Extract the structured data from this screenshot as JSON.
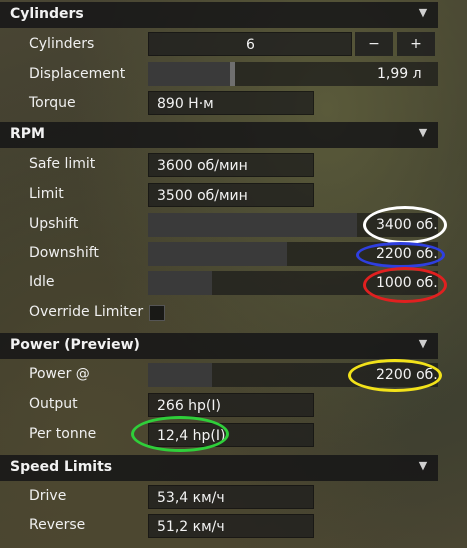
{
  "sections": {
    "cylinders": {
      "title": "Cylinders",
      "cylinders_label": "Cylinders",
      "cylinders_value": "6",
      "minus_label": "−",
      "plus_label": "+",
      "displacement_label": "Displacement",
      "displacement_value": "1,99 л",
      "displacement_fill": 0.3,
      "torque_label": "Torque",
      "torque_value": "890 Н·м"
    },
    "rpm": {
      "title": "RPM",
      "safe_limit_label": "Safe limit",
      "safe_limit_value": "3600 об/мин",
      "limit_label": "Limit",
      "limit_value": "3500 об/мин",
      "upshift_label": "Upshift",
      "upshift_value": "3400 об.",
      "upshift_fill": 0.72,
      "downshift_label": "Downshift",
      "downshift_value": "2200 об.",
      "downshift_fill": 0.48,
      "idle_label": "Idle",
      "idle_value": "1000 об.",
      "idle_fill": 0.22,
      "override_label": "Override Limiter"
    },
    "power": {
      "title": "Power (Preview)",
      "power_at_label": "Power @",
      "power_at_value": "2200 об.",
      "power_at_fill": 0.22,
      "output_label": "Output",
      "output_value": "266 hp(I)",
      "per_tonne_label": "Per tonne",
      "per_tonne_value": "12,4 hp(I)"
    },
    "speed": {
      "title": "Speed Limits",
      "drive_label": "Drive",
      "drive_value": "53,4 км/ч",
      "reverse_label": "Reverse",
      "reverse_value": "51,2 км/ч"
    }
  },
  "annotation_colors": {
    "upshift": "#ffffff",
    "downshift": "#2f3fe0",
    "idle": "#e02020",
    "power_at": "#f2e21a",
    "per_tonne": "#2fcf3a"
  }
}
